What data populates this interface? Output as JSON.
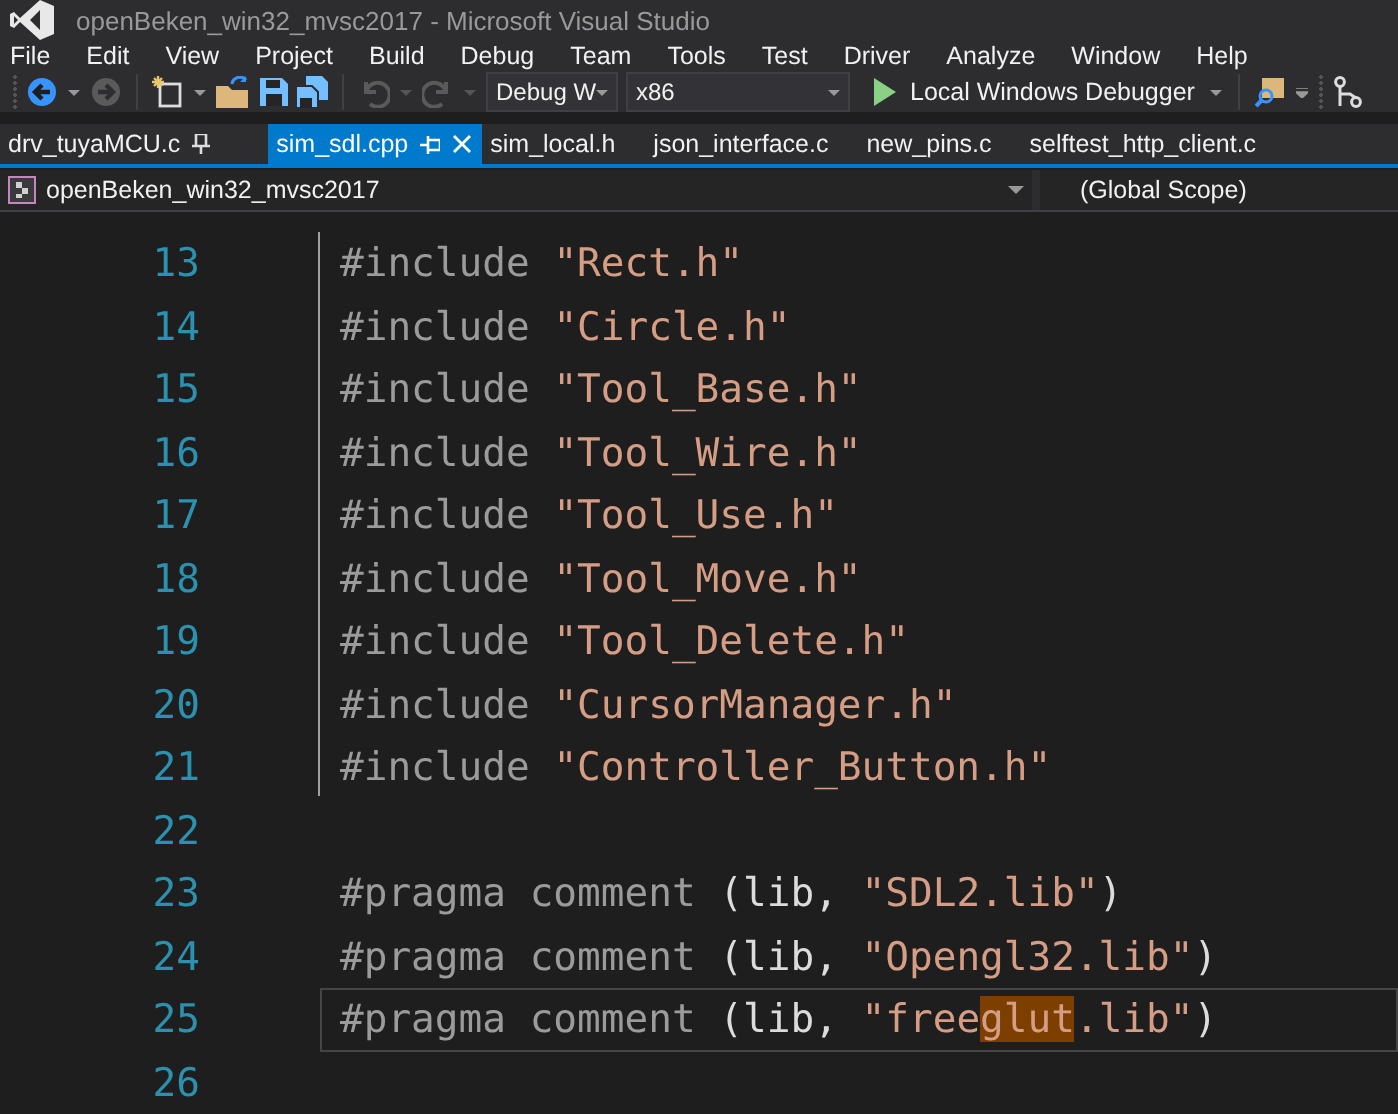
{
  "window": {
    "title": "openBeken_win32_mvsc2017 - Microsoft Visual Studio"
  },
  "menu": [
    {
      "label": "File"
    },
    {
      "label": "Edit"
    },
    {
      "label": "View"
    },
    {
      "label": "Project"
    },
    {
      "label": "Build"
    },
    {
      "label": "Debug"
    },
    {
      "label": "Team"
    },
    {
      "label": "Tools"
    },
    {
      "label": "Test"
    },
    {
      "label": "Driver"
    },
    {
      "label": "Analyze"
    },
    {
      "label": "Window"
    },
    {
      "label": "Help"
    }
  ],
  "toolbar": {
    "configuration": "Debug W",
    "platform": "x86",
    "debugger": "Local Windows Debugger"
  },
  "tabs": [
    {
      "label": "drv_tuyaMCU.c",
      "selected": false,
      "pinned": true
    },
    {
      "label": "sim_sdl.cpp",
      "selected": true,
      "pinned": false
    },
    {
      "label": "sim_local.h",
      "selected": false,
      "pinned": false
    },
    {
      "label": "json_interface.c",
      "selected": false,
      "pinned": false
    },
    {
      "label": "new_pins.c",
      "selected": false,
      "pinned": false
    },
    {
      "label": "selftest_http_client.c",
      "selected": false,
      "pinned": false
    }
  ],
  "navigation": {
    "project": "openBeken_win32_mvsc2017",
    "scope": "(Global Scope)"
  },
  "editor": {
    "lines": [
      {
        "number": "13",
        "current": false,
        "segments": [
          {
            "kind": "directive",
            "text": "#include "
          },
          {
            "kind": "string",
            "text": "\"Rect.h\""
          }
        ]
      },
      {
        "number": "14",
        "current": false,
        "segments": [
          {
            "kind": "directive",
            "text": "#include "
          },
          {
            "kind": "string",
            "text": "\"Circle.h\""
          }
        ]
      },
      {
        "number": "15",
        "current": false,
        "segments": [
          {
            "kind": "directive",
            "text": "#include "
          },
          {
            "kind": "string",
            "text": "\"Tool_Base.h\""
          }
        ]
      },
      {
        "number": "16",
        "current": false,
        "segments": [
          {
            "kind": "directive",
            "text": "#include "
          },
          {
            "kind": "string",
            "text": "\"Tool_Wire.h\""
          }
        ]
      },
      {
        "number": "17",
        "current": false,
        "segments": [
          {
            "kind": "directive",
            "text": "#include "
          },
          {
            "kind": "string",
            "text": "\"Tool_Use.h\""
          }
        ]
      },
      {
        "number": "18",
        "current": false,
        "segments": [
          {
            "kind": "directive",
            "text": "#include "
          },
          {
            "kind": "string",
            "text": "\"Tool_Move.h\""
          }
        ]
      },
      {
        "number": "19",
        "current": false,
        "segments": [
          {
            "kind": "directive",
            "text": "#include "
          },
          {
            "kind": "string",
            "text": "\"Tool_Delete.h\""
          }
        ]
      },
      {
        "number": "20",
        "current": false,
        "segments": [
          {
            "kind": "directive",
            "text": "#include "
          },
          {
            "kind": "string",
            "text": "\"CursorManager.h\""
          }
        ]
      },
      {
        "number": "21",
        "current": false,
        "segments": [
          {
            "kind": "directive",
            "text": "#include "
          },
          {
            "kind": "string",
            "text": "\"Controller_Button.h\""
          }
        ]
      },
      {
        "number": "22",
        "current": false
      },
      {
        "number": "23",
        "current": false,
        "segments": [
          {
            "kind": "directive",
            "text": "#pragma comment "
          },
          {
            "kind": "plain",
            "text": "(lib, "
          },
          {
            "kind": "string",
            "text": "\"SDL2.lib\""
          },
          {
            "kind": "plain",
            "text": ")"
          }
        ]
      },
      {
        "number": "24",
        "current": false,
        "segments": [
          {
            "kind": "directive",
            "text": "#pragma comment "
          },
          {
            "kind": "plain",
            "text": "(lib, "
          },
          {
            "kind": "string",
            "text": "\"Opengl32.lib\""
          },
          {
            "kind": "plain",
            "text": ")"
          }
        ]
      },
      {
        "number": "25",
        "current": true,
        "segments": [
          {
            "kind": "directive",
            "text": "#pragma comment "
          },
          {
            "kind": "plain",
            "text": "(lib, "
          },
          {
            "kind": "string",
            "text": "\"free"
          },
          {
            "kind": "string",
            "text": "glut",
            "highlighted": true
          },
          {
            "kind": "string",
            "text": ".lib\""
          },
          {
            "kind": "plain",
            "text": ")"
          }
        ]
      },
      {
        "number": "26",
        "current": false
      }
    ]
  }
}
